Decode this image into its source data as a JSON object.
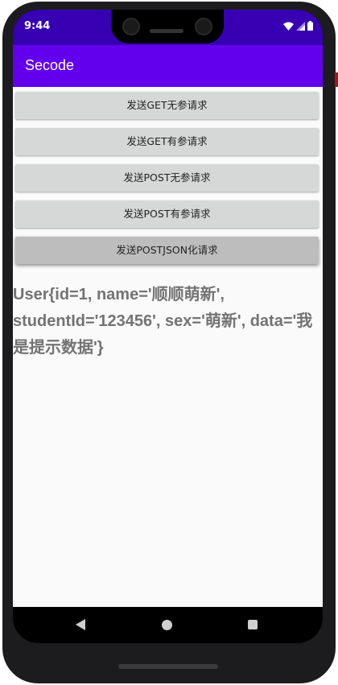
{
  "status_bar": {
    "time": "9:44",
    "icons": [
      "wifi-icon",
      "signal-icon",
      "battery-icon"
    ]
  },
  "app_bar": {
    "title": "Secode"
  },
  "buttons": [
    {
      "label": "发送GET无参请求"
    },
    {
      "label": "发送GET有参请求"
    },
    {
      "label": "发送POST无参请求"
    },
    {
      "label": "发送POST有参请求"
    },
    {
      "label": "发送POSTJSON化请求"
    }
  ],
  "result_text": "User{id=1, name='顺顺萌新', studentId='123456', sex='萌新', data='我是提示数据'}",
  "nav_bar": {
    "icons": [
      "back-icon",
      "home-icon",
      "recents-icon"
    ]
  },
  "colors": {
    "status_bar": "#3700b3",
    "app_bar": "#6200ee",
    "button": "#d6d7d7",
    "result_text": "#737373"
  }
}
